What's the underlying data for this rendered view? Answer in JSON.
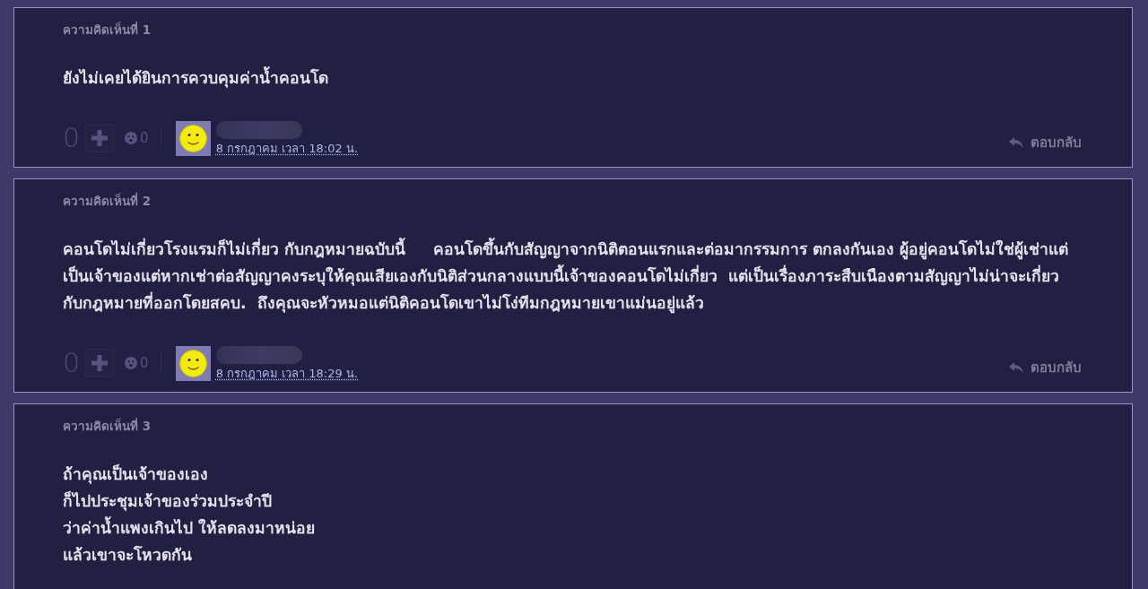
{
  "comments": [
    {
      "header": "ความคิดเห็นที่ 1",
      "body": "ยังไม่เคยได้ยินการควบคุมค่าน้ำคอนโด",
      "score": "0",
      "emotion_count": "0",
      "date": "8 กรกฎาคม เวลา 18:02 น.",
      "reply": "ตอบกลับ"
    },
    {
      "header": "ความคิดเห็นที่ 2",
      "body": "คอนโดไม่เกี่ยวโรงแรมก็ไม่เกี่ยว กับกฎหมายฉบับนี้     คอนโดขึ้นกับสัญญาจากนิติตอนแรกและต่อมากรรมการ ตกลงกันเอง ผู้อยู่คอนโดไม่ใช่ผู้เช่าแต่เป็นเจ้าของแต่หากเช่าต่อสัญญาคงระบุให้คุณเสียเองกับนิติส่วนกลางแบบนี้เจ้าของคอนโดไม่เกี่ยว  แต่เป็นเรื่องภาระสืบเนืองตามสัญญาไม่น่าจะเกี่ยวกับกฎหมายที่ออกโดยสคบ.  ถึงคุณจะหัวหมอแต่นิติคอนโดเขาไม่โง่ทีมกฎหมายเขาแม่นอยู่แล้ว",
      "score": "0",
      "emotion_count": "0",
      "date": "8 กรกฎาคม เวลา 18:29 น.",
      "reply": "ตอบกลับ"
    },
    {
      "header": "ความคิดเห็นที่ 3",
      "body": "ถ้าคุณเป็นเจ้าของเอง\nก็ไปประชุมเจ้าของร่วมประจำปี\nว่าค่าน้ำแพงเกินไป ให้ลดลงมาหน่อย\nแล้วเขาจะโหวดกัน"
    }
  ]
}
